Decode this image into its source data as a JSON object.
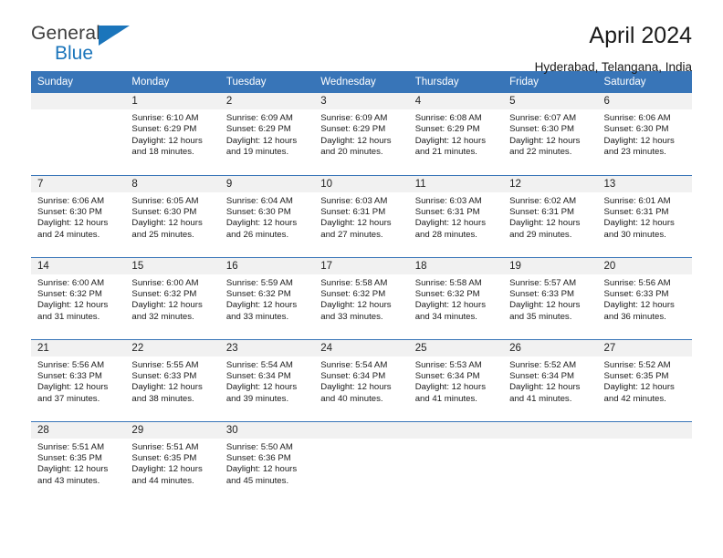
{
  "brand": {
    "name_part1": "General",
    "name_part2": "Blue",
    "accent_color": "#1b75bb"
  },
  "header": {
    "title": "April 2024",
    "subtitle": "Hyderabad, Telangana, India"
  },
  "theme": {
    "header_row_bg": "#3875b8",
    "daynum_bg": "#f1f1f1",
    "separator_color": "#3875b8"
  },
  "weekday_headers": [
    "Sunday",
    "Monday",
    "Tuesday",
    "Wednesday",
    "Thursday",
    "Friday",
    "Saturday"
  ],
  "weeks": [
    {
      "days": [
        {
          "num": "",
          "sunrise": "",
          "sunset": "",
          "daylight_line1": "",
          "daylight_line2": "",
          "empty": true
        },
        {
          "num": "1",
          "sunrise": "Sunrise: 6:10 AM",
          "sunset": "Sunset: 6:29 PM",
          "daylight_line1": "Daylight: 12 hours",
          "daylight_line2": "and 18 minutes.",
          "empty": false
        },
        {
          "num": "2",
          "sunrise": "Sunrise: 6:09 AM",
          "sunset": "Sunset: 6:29 PM",
          "daylight_line1": "Daylight: 12 hours",
          "daylight_line2": "and 19 minutes.",
          "empty": false
        },
        {
          "num": "3",
          "sunrise": "Sunrise: 6:09 AM",
          "sunset": "Sunset: 6:29 PM",
          "daylight_line1": "Daylight: 12 hours",
          "daylight_line2": "and 20 minutes.",
          "empty": false
        },
        {
          "num": "4",
          "sunrise": "Sunrise: 6:08 AM",
          "sunset": "Sunset: 6:29 PM",
          "daylight_line1": "Daylight: 12 hours",
          "daylight_line2": "and 21 minutes.",
          "empty": false
        },
        {
          "num": "5",
          "sunrise": "Sunrise: 6:07 AM",
          "sunset": "Sunset: 6:30 PM",
          "daylight_line1": "Daylight: 12 hours",
          "daylight_line2": "and 22 minutes.",
          "empty": false
        },
        {
          "num": "6",
          "sunrise": "Sunrise: 6:06 AM",
          "sunset": "Sunset: 6:30 PM",
          "daylight_line1": "Daylight: 12 hours",
          "daylight_line2": "and 23 minutes.",
          "empty": false
        }
      ]
    },
    {
      "days": [
        {
          "num": "7",
          "sunrise": "Sunrise: 6:06 AM",
          "sunset": "Sunset: 6:30 PM",
          "daylight_line1": "Daylight: 12 hours",
          "daylight_line2": "and 24 minutes.",
          "empty": false
        },
        {
          "num": "8",
          "sunrise": "Sunrise: 6:05 AM",
          "sunset": "Sunset: 6:30 PM",
          "daylight_line1": "Daylight: 12 hours",
          "daylight_line2": "and 25 minutes.",
          "empty": false
        },
        {
          "num": "9",
          "sunrise": "Sunrise: 6:04 AM",
          "sunset": "Sunset: 6:30 PM",
          "daylight_line1": "Daylight: 12 hours",
          "daylight_line2": "and 26 minutes.",
          "empty": false
        },
        {
          "num": "10",
          "sunrise": "Sunrise: 6:03 AM",
          "sunset": "Sunset: 6:31 PM",
          "daylight_line1": "Daylight: 12 hours",
          "daylight_line2": "and 27 minutes.",
          "empty": false
        },
        {
          "num": "11",
          "sunrise": "Sunrise: 6:03 AM",
          "sunset": "Sunset: 6:31 PM",
          "daylight_line1": "Daylight: 12 hours",
          "daylight_line2": "and 28 minutes.",
          "empty": false
        },
        {
          "num": "12",
          "sunrise": "Sunrise: 6:02 AM",
          "sunset": "Sunset: 6:31 PM",
          "daylight_line1": "Daylight: 12 hours",
          "daylight_line2": "and 29 minutes.",
          "empty": false
        },
        {
          "num": "13",
          "sunrise": "Sunrise: 6:01 AM",
          "sunset": "Sunset: 6:31 PM",
          "daylight_line1": "Daylight: 12 hours",
          "daylight_line2": "and 30 minutes.",
          "empty": false
        }
      ]
    },
    {
      "days": [
        {
          "num": "14",
          "sunrise": "Sunrise: 6:00 AM",
          "sunset": "Sunset: 6:32 PM",
          "daylight_line1": "Daylight: 12 hours",
          "daylight_line2": "and 31 minutes.",
          "empty": false
        },
        {
          "num": "15",
          "sunrise": "Sunrise: 6:00 AM",
          "sunset": "Sunset: 6:32 PM",
          "daylight_line1": "Daylight: 12 hours",
          "daylight_line2": "and 32 minutes.",
          "empty": false
        },
        {
          "num": "16",
          "sunrise": "Sunrise: 5:59 AM",
          "sunset": "Sunset: 6:32 PM",
          "daylight_line1": "Daylight: 12 hours",
          "daylight_line2": "and 33 minutes.",
          "empty": false
        },
        {
          "num": "17",
          "sunrise": "Sunrise: 5:58 AM",
          "sunset": "Sunset: 6:32 PM",
          "daylight_line1": "Daylight: 12 hours",
          "daylight_line2": "and 33 minutes.",
          "empty": false
        },
        {
          "num": "18",
          "sunrise": "Sunrise: 5:58 AM",
          "sunset": "Sunset: 6:32 PM",
          "daylight_line1": "Daylight: 12 hours",
          "daylight_line2": "and 34 minutes.",
          "empty": false
        },
        {
          "num": "19",
          "sunrise": "Sunrise: 5:57 AM",
          "sunset": "Sunset: 6:33 PM",
          "daylight_line1": "Daylight: 12 hours",
          "daylight_line2": "and 35 minutes.",
          "empty": false
        },
        {
          "num": "20",
          "sunrise": "Sunrise: 5:56 AM",
          "sunset": "Sunset: 6:33 PM",
          "daylight_line1": "Daylight: 12 hours",
          "daylight_line2": "and 36 minutes.",
          "empty": false
        }
      ]
    },
    {
      "days": [
        {
          "num": "21",
          "sunrise": "Sunrise: 5:56 AM",
          "sunset": "Sunset: 6:33 PM",
          "daylight_line1": "Daylight: 12 hours",
          "daylight_line2": "and 37 minutes.",
          "empty": false
        },
        {
          "num": "22",
          "sunrise": "Sunrise: 5:55 AM",
          "sunset": "Sunset: 6:33 PM",
          "daylight_line1": "Daylight: 12 hours",
          "daylight_line2": "and 38 minutes.",
          "empty": false
        },
        {
          "num": "23",
          "sunrise": "Sunrise: 5:54 AM",
          "sunset": "Sunset: 6:34 PM",
          "daylight_line1": "Daylight: 12 hours",
          "daylight_line2": "and 39 minutes.",
          "empty": false
        },
        {
          "num": "24",
          "sunrise": "Sunrise: 5:54 AM",
          "sunset": "Sunset: 6:34 PM",
          "daylight_line1": "Daylight: 12 hours",
          "daylight_line2": "and 40 minutes.",
          "empty": false
        },
        {
          "num": "25",
          "sunrise": "Sunrise: 5:53 AM",
          "sunset": "Sunset: 6:34 PM",
          "daylight_line1": "Daylight: 12 hours",
          "daylight_line2": "and 41 minutes.",
          "empty": false
        },
        {
          "num": "26",
          "sunrise": "Sunrise: 5:52 AM",
          "sunset": "Sunset: 6:34 PM",
          "daylight_line1": "Daylight: 12 hours",
          "daylight_line2": "and 41 minutes.",
          "empty": false
        },
        {
          "num": "27",
          "sunrise": "Sunrise: 5:52 AM",
          "sunset": "Sunset: 6:35 PM",
          "daylight_line1": "Daylight: 12 hours",
          "daylight_line2": "and 42 minutes.",
          "empty": false
        }
      ]
    },
    {
      "days": [
        {
          "num": "28",
          "sunrise": "Sunrise: 5:51 AM",
          "sunset": "Sunset: 6:35 PM",
          "daylight_line1": "Daylight: 12 hours",
          "daylight_line2": "and 43 minutes.",
          "empty": false
        },
        {
          "num": "29",
          "sunrise": "Sunrise: 5:51 AM",
          "sunset": "Sunset: 6:35 PM",
          "daylight_line1": "Daylight: 12 hours",
          "daylight_line2": "and 44 minutes.",
          "empty": false
        },
        {
          "num": "30",
          "sunrise": "Sunrise: 5:50 AM",
          "sunset": "Sunset: 6:36 PM",
          "daylight_line1": "Daylight: 12 hours",
          "daylight_line2": "and 45 minutes.",
          "empty": false
        },
        {
          "num": "",
          "sunrise": "",
          "sunset": "",
          "daylight_line1": "",
          "daylight_line2": "",
          "empty": true
        },
        {
          "num": "",
          "sunrise": "",
          "sunset": "",
          "daylight_line1": "",
          "daylight_line2": "",
          "empty": true
        },
        {
          "num": "",
          "sunrise": "",
          "sunset": "",
          "daylight_line1": "",
          "daylight_line2": "",
          "empty": true
        },
        {
          "num": "",
          "sunrise": "",
          "sunset": "",
          "daylight_line1": "",
          "daylight_line2": "",
          "empty": true
        }
      ]
    }
  ]
}
